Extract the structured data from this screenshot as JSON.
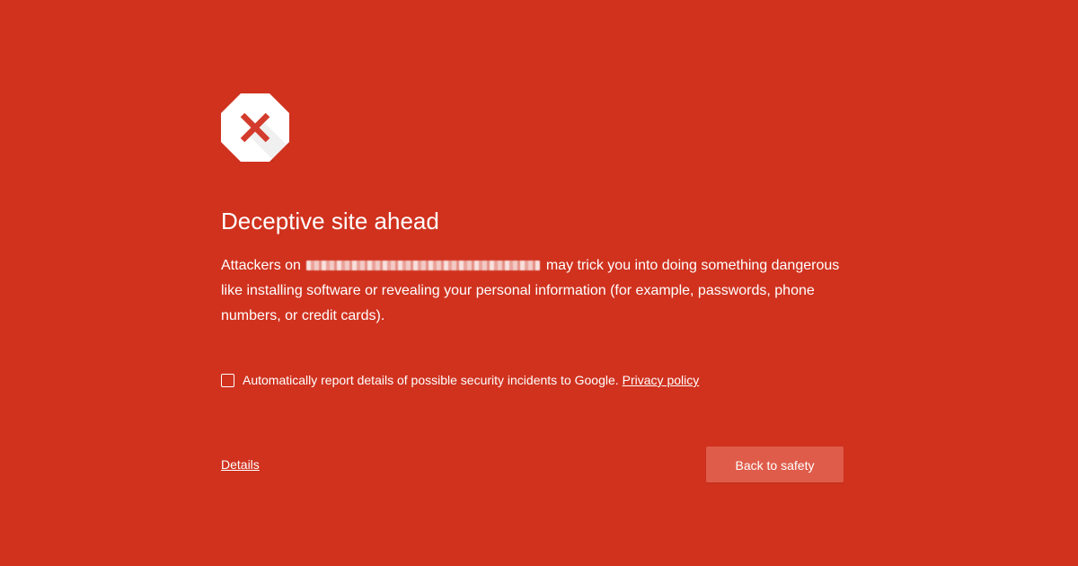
{
  "colors": {
    "background": "#d0321e",
    "button": "#df5c4a",
    "text": "#ffffff",
    "icon_cross": "#d33b2c"
  },
  "icon": {
    "name": "stop-sign-x-icon"
  },
  "heading": "Deceptive site ahead",
  "description": {
    "prefix": "Attackers on",
    "suffix": "may trick you into doing something dangerous like installing software or revealing your personal information (for example, passwords, phone numbers, or credit cards)."
  },
  "report": {
    "checked": false,
    "label": "Automatically report details of possible security incidents to Google.",
    "privacy_link": "Privacy policy"
  },
  "details_link": "Details",
  "back_button": "Back to safety"
}
